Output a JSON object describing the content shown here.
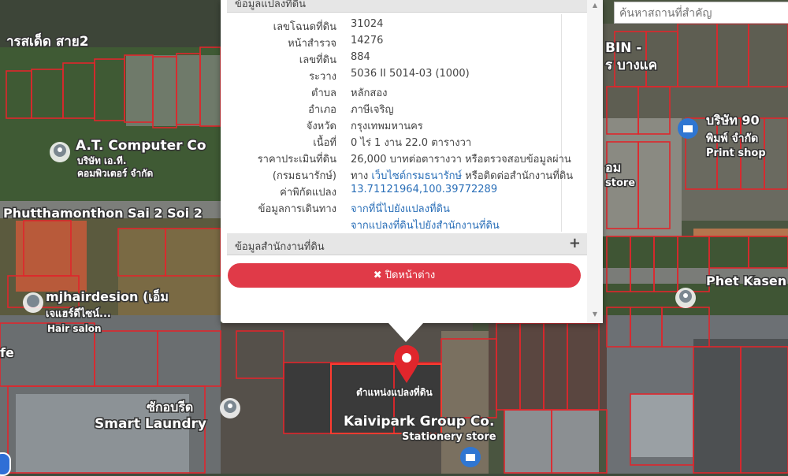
{
  "search": {
    "placeholder": "ค้นหาสถานที่สำคัญ"
  },
  "map_labels": {
    "street_top": "ารสเด็ด สาย2",
    "at_computer": "A.T. Computer Co",
    "at_computer_th1": "บริษัท เอ.ที.",
    "at_computer_th2": "คอมพิวเตอร์ จำกัด",
    "road": "Phutthamonthon Sai 2 Soi 2",
    "mjhair": "mjhairdesion (เอ็ม",
    "mjhair_th": "เจแฮร์ดีไซน์...",
    "hairsalon": "Hair salon",
    "fe": "fe",
    "laundry_th": "ซักอบรีด",
    "laundry": "Smart Laundry",
    "parcel_pin": "ตำแหน่งแปลงที่ดิน",
    "kaivipark": "Kaivipark Group Co.",
    "stationery": "Stationery store",
    "bin": "BIN -",
    "bangkae": "ร บางแค",
    "company90": "บริษัท 90",
    "company90_b": "พิมพ์ จำกัด",
    "printshop": "Print shop",
    "om": "อม",
    "store": "store",
    "phet_kasem": "Phet Kasen"
  },
  "popup": {
    "header_top": "ข้อมูลแปลงที่ดิน",
    "rows": [
      {
        "label": "เลขโฉนดที่ดิน",
        "value": "31024"
      },
      {
        "label": "หน้าสำรวจ",
        "value": "14276"
      },
      {
        "label": "เลขที่ดิน",
        "value": "884"
      },
      {
        "label": "ระวาง",
        "value": "5036 II 5014-03 (1000)"
      },
      {
        "label": "ตำบล",
        "value": "หลักสอง"
      },
      {
        "label": "อำเภอ",
        "value": "ภาษีเจริญ"
      },
      {
        "label": "จังหวัด",
        "value": "กรุงเทพมหานคร"
      },
      {
        "label": "เนื้อที่",
        "value": "0 ไร่ 1 งาน 22.0 ตารางวา"
      }
    ],
    "price": {
      "label1": "ราคาประเมินที่ดิน",
      "label2": "(กรมธนารักษ์)",
      "line1": "26,000 บาทต่อตารางวา หรือตรวจสอบข้อมูลผ่าน",
      "line2_pre": "ทาง",
      "line2_link": "เว็บไซต์กรมธนารักษ์",
      "line2_post": "หรือติดต่อสำนักงานที่ดิน"
    },
    "coords": {
      "label": "ค่าพิกัดแปลง",
      "value": "13.71121964,100.39772289"
    },
    "travel": {
      "label": "ข้อมูลการเดินทาง",
      "link1": "จากที่นี่ไปยังแปลงที่ดิน",
      "link2": "จากแปลงที่ดินไปยังสำนักงานที่ดิน"
    },
    "office_header": "ข้อมูลสำนักงานที่ดิน",
    "close_label": "✖ ปิดหน้าต่าง"
  }
}
